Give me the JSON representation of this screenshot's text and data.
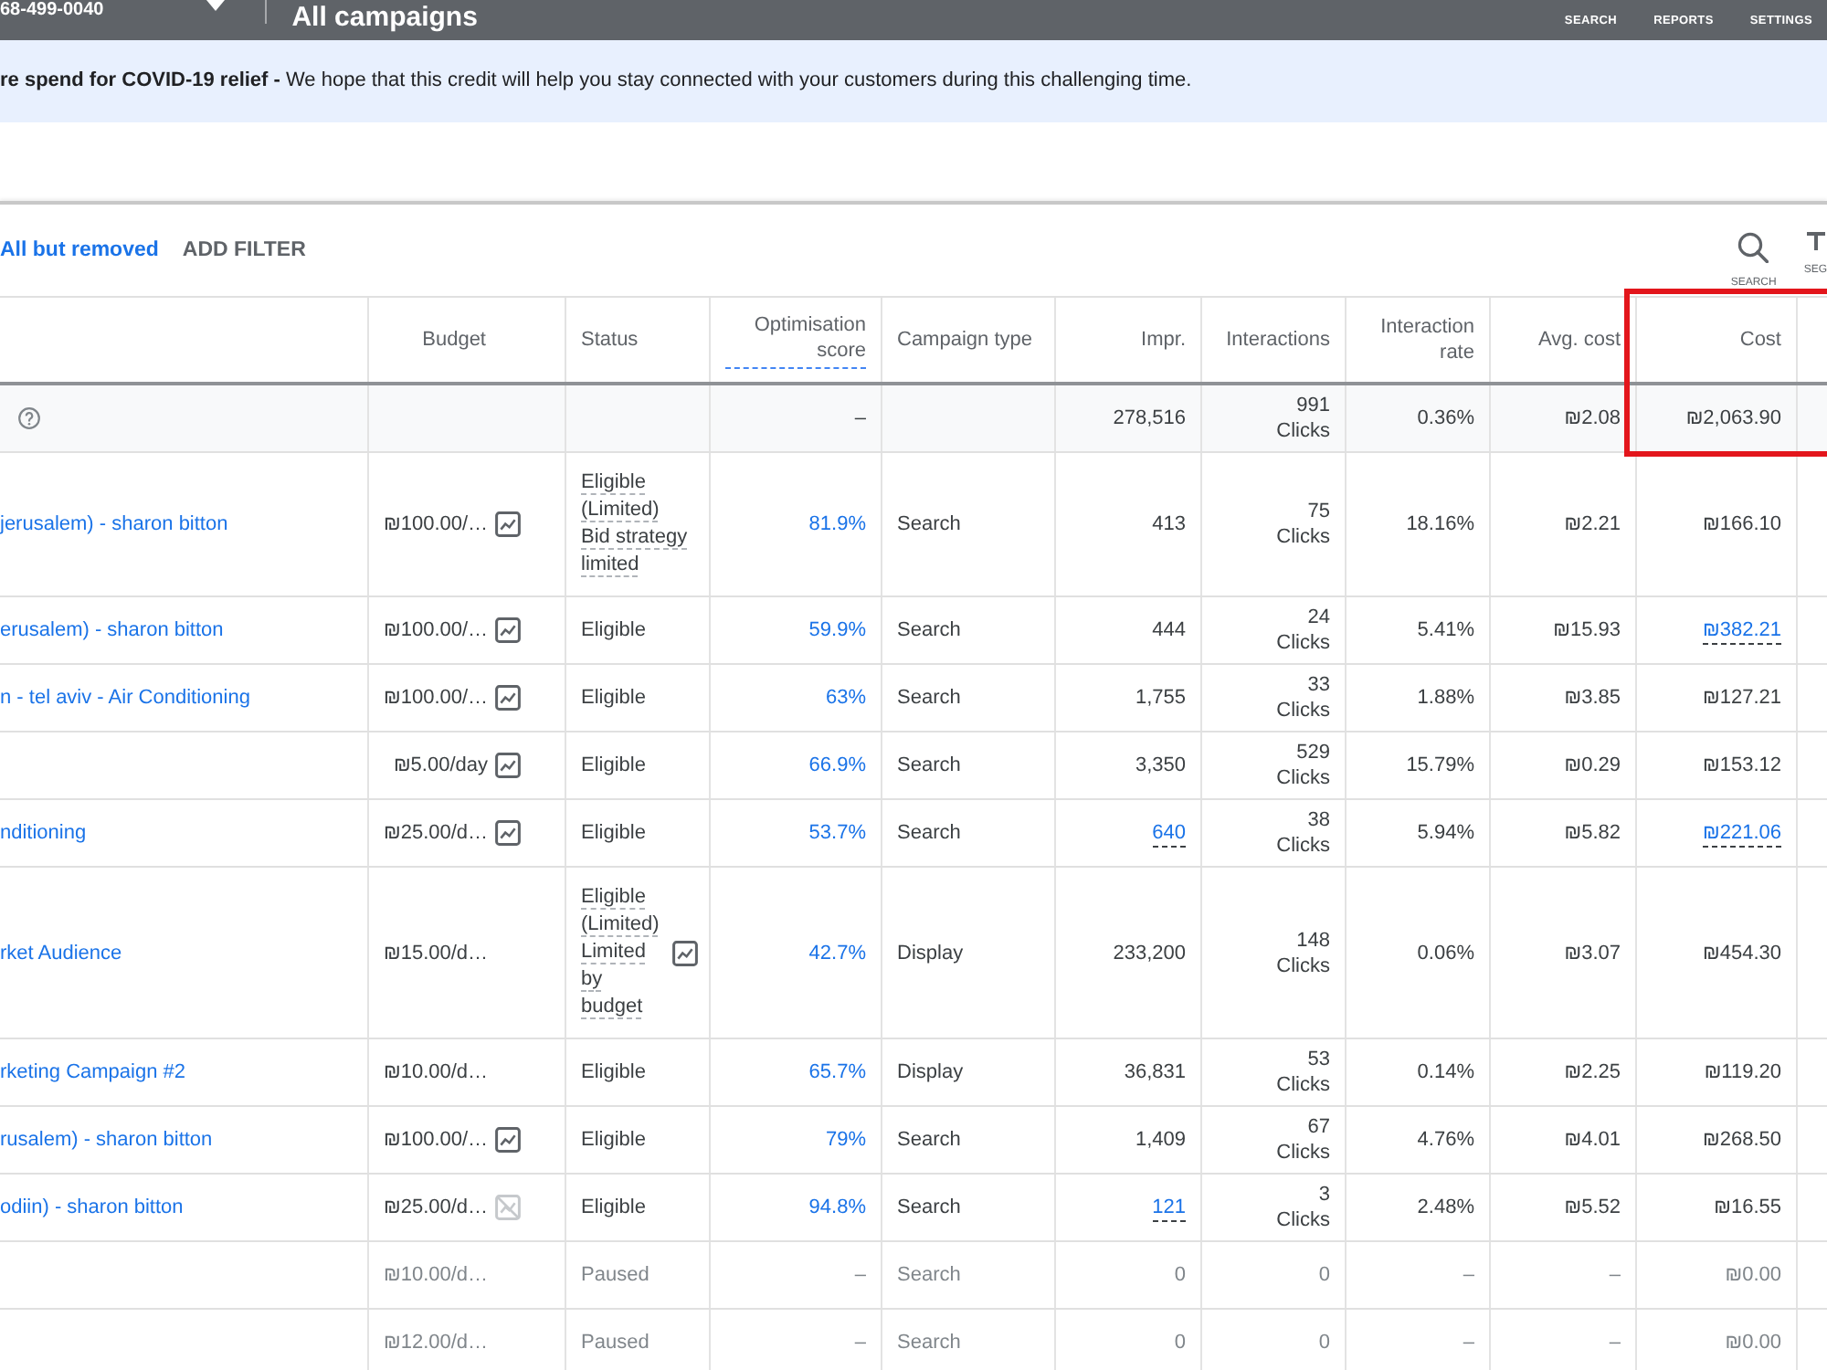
{
  "top_bar": {
    "account": "68-499-0040",
    "title": "All campaigns",
    "nav": [
      "SEARCH",
      "REPORTS",
      "SETTINGS"
    ]
  },
  "banner": {
    "text": "**re spend for COVID-19 relief -** We hope that this credit will help you stay connected with your customers during this challenging time."
  },
  "filter_bar": {
    "status_filter": "All but removed",
    "add_filter": "ADD FILTER",
    "tools": [
      {
        "kind": "search",
        "label": "SEARCH"
      },
      {
        "kind": "tee",
        "label": "SEG"
      }
    ]
  },
  "table": {
    "columns": [
      {
        "label": "Budget",
        "underlined": false,
        "highlighted": false
      },
      {
        "label": "Status",
        "underlined": false,
        "highlighted": false
      },
      {
        "label": "Optimisation score",
        "underlined": true,
        "highlighted": false
      },
      {
        "label": "Campaign type",
        "underlined": false,
        "highlighted": false
      },
      {
        "label": "Impr.",
        "underlined": false,
        "highlighted": false
      },
      {
        "label": "Interactions",
        "underlined": false,
        "highlighted": false
      },
      {
        "label": "Interaction rate",
        "underlined": false,
        "highlighted": false
      },
      {
        "label": "Avg. cost",
        "underlined": false,
        "highlighted": false
      },
      {
        "label": "Cost",
        "underlined": false,
        "highlighted": true
      }
    ],
    "total": {
      "score": "–",
      "impr": "278,516",
      "interactions": "991",
      "interactions_unit": "Clicks",
      "rate": "0.36%",
      "avg_cost": "₪2.08",
      "cost": "₪2,063.90"
    },
    "rows": [
      {
        "name": "jerusalem) - sharon bitton",
        "budget": "₪100.00/…",
        "budget_chart": {
          "disabled": false
        },
        "status": "Eligible (Limited)",
        "status_detail": "Bid strategy limited",
        "limited": true,
        "paused": false,
        "score": "81.9%",
        "type": "Search",
        "impr": "413",
        "impr_linked": false,
        "interactions": "75",
        "interactions_unit": "Clicks",
        "rate": "18.16%",
        "avg_cost": "₪2.21",
        "cost": "₪166.10",
        "cost_linked": false
      },
      {
        "name": "erusalem) - sharon bitton",
        "budget": "₪100.00/…",
        "budget_chart": {
          "disabled": false
        },
        "status": "Eligible",
        "limited": false,
        "paused": false,
        "score": "59.9%",
        "type": "Search",
        "impr": "444",
        "impr_linked": false,
        "interactions": "24",
        "interactions_unit": "Clicks",
        "rate": "5.41%",
        "avg_cost": "₪15.93",
        "cost": "₪382.21",
        "cost_linked": true
      },
      {
        "name": "n - tel aviv - Air Conditioning",
        "budget": "₪100.00/…",
        "budget_chart": {
          "disabled": false
        },
        "status": "Eligible",
        "limited": false,
        "paused": false,
        "score": "63%",
        "type": "Search",
        "impr": "1,755",
        "impr_linked": false,
        "interactions": "33",
        "interactions_unit": "Clicks",
        "rate": "1.88%",
        "avg_cost": "₪3.85",
        "cost": "₪127.21",
        "cost_linked": false
      },
      {
        "budget": "₪5.00/day",
        "budget_chart": {
          "disabled": false
        },
        "status": "Eligible",
        "limited": false,
        "paused": false,
        "score": "66.9%",
        "type": "Search",
        "impr": "3,350",
        "impr_linked": false,
        "interactions": "529",
        "interactions_unit": "Clicks",
        "rate": "15.79%",
        "avg_cost": "₪0.29",
        "cost": "₪153.12",
        "cost_linked": false
      },
      {
        "name": "nditioning",
        "budget": "₪25.00/d…",
        "budget_chart": {
          "disabled": false
        },
        "status": "Eligible",
        "limited": false,
        "paused": false,
        "score": "53.7%",
        "type": "Search",
        "impr": "640",
        "impr_linked": true,
        "interactions": "38",
        "interactions_unit": "Clicks",
        "rate": "5.94%",
        "avg_cost": "₪5.82",
        "cost": "₪221.06",
        "cost_linked": true
      },
      {
        "name": "rket Audience",
        "budget": "₪15.00/d…",
        "status": "Eligible (Limited)",
        "status_detail": "Limited by budget",
        "status_chart": {
          "disabled": false
        },
        "limited": true,
        "paused": false,
        "score": "42.7%",
        "type": "Display",
        "impr": "233,200",
        "impr_linked": false,
        "interactions": "148",
        "interactions_unit": "Clicks",
        "rate": "0.06%",
        "avg_cost": "₪3.07",
        "cost": "₪454.30",
        "cost_linked": false
      },
      {
        "name": "rketing Campaign #2",
        "budget": "₪10.00/d…",
        "status": "Eligible",
        "limited": false,
        "paused": false,
        "score": "65.7%",
        "type": "Display",
        "impr": "36,831",
        "impr_linked": false,
        "interactions": "53",
        "interactions_unit": "Clicks",
        "rate": "0.14%",
        "avg_cost": "₪2.25",
        "cost": "₪119.20",
        "cost_linked": false
      },
      {
        "name": "rusalem) - sharon bitton",
        "budget": "₪100.00/…",
        "budget_chart": {
          "disabled": false
        },
        "status": "Eligible",
        "limited": false,
        "paused": false,
        "score": "79%",
        "type": "Search",
        "impr": "1,409",
        "impr_linked": false,
        "interactions": "67",
        "interactions_unit": "Clicks",
        "rate": "4.76%",
        "avg_cost": "₪4.01",
        "cost": "₪268.50",
        "cost_linked": false
      },
      {
        "name": "odiin) - sharon bitton",
        "budget": "₪25.00/d…",
        "budget_chart": {
          "disabled": true
        },
        "status": "Eligible",
        "limited": false,
        "paused": false,
        "score": "94.8%",
        "type": "Search",
        "impr": "121",
        "impr_linked": true,
        "interactions": "3",
        "interactions_unit": "Clicks",
        "rate": "2.48%",
        "avg_cost": "₪5.52",
        "cost": "₪16.55",
        "cost_linked": false
      },
      {
        "budget": "₪10.00/d…",
        "status": "Paused",
        "limited": false,
        "paused": true,
        "score": "–",
        "type": "Search",
        "impr": "0",
        "impr_linked": false,
        "interactions": "0",
        "rate": "–",
        "avg_cost": "–",
        "cost": "₪0.00",
        "cost_linked": false
      },
      {
        "budget": "₪12.00/d…",
        "status": "Paused",
        "limited": false,
        "paused": true,
        "score": "–",
        "type": "Search",
        "impr": "0",
        "impr_linked": false,
        "interactions": "0",
        "rate": "–",
        "avg_cost": "–",
        "cost": "₪0.00",
        "cost_linked": false
      }
    ]
  }
}
